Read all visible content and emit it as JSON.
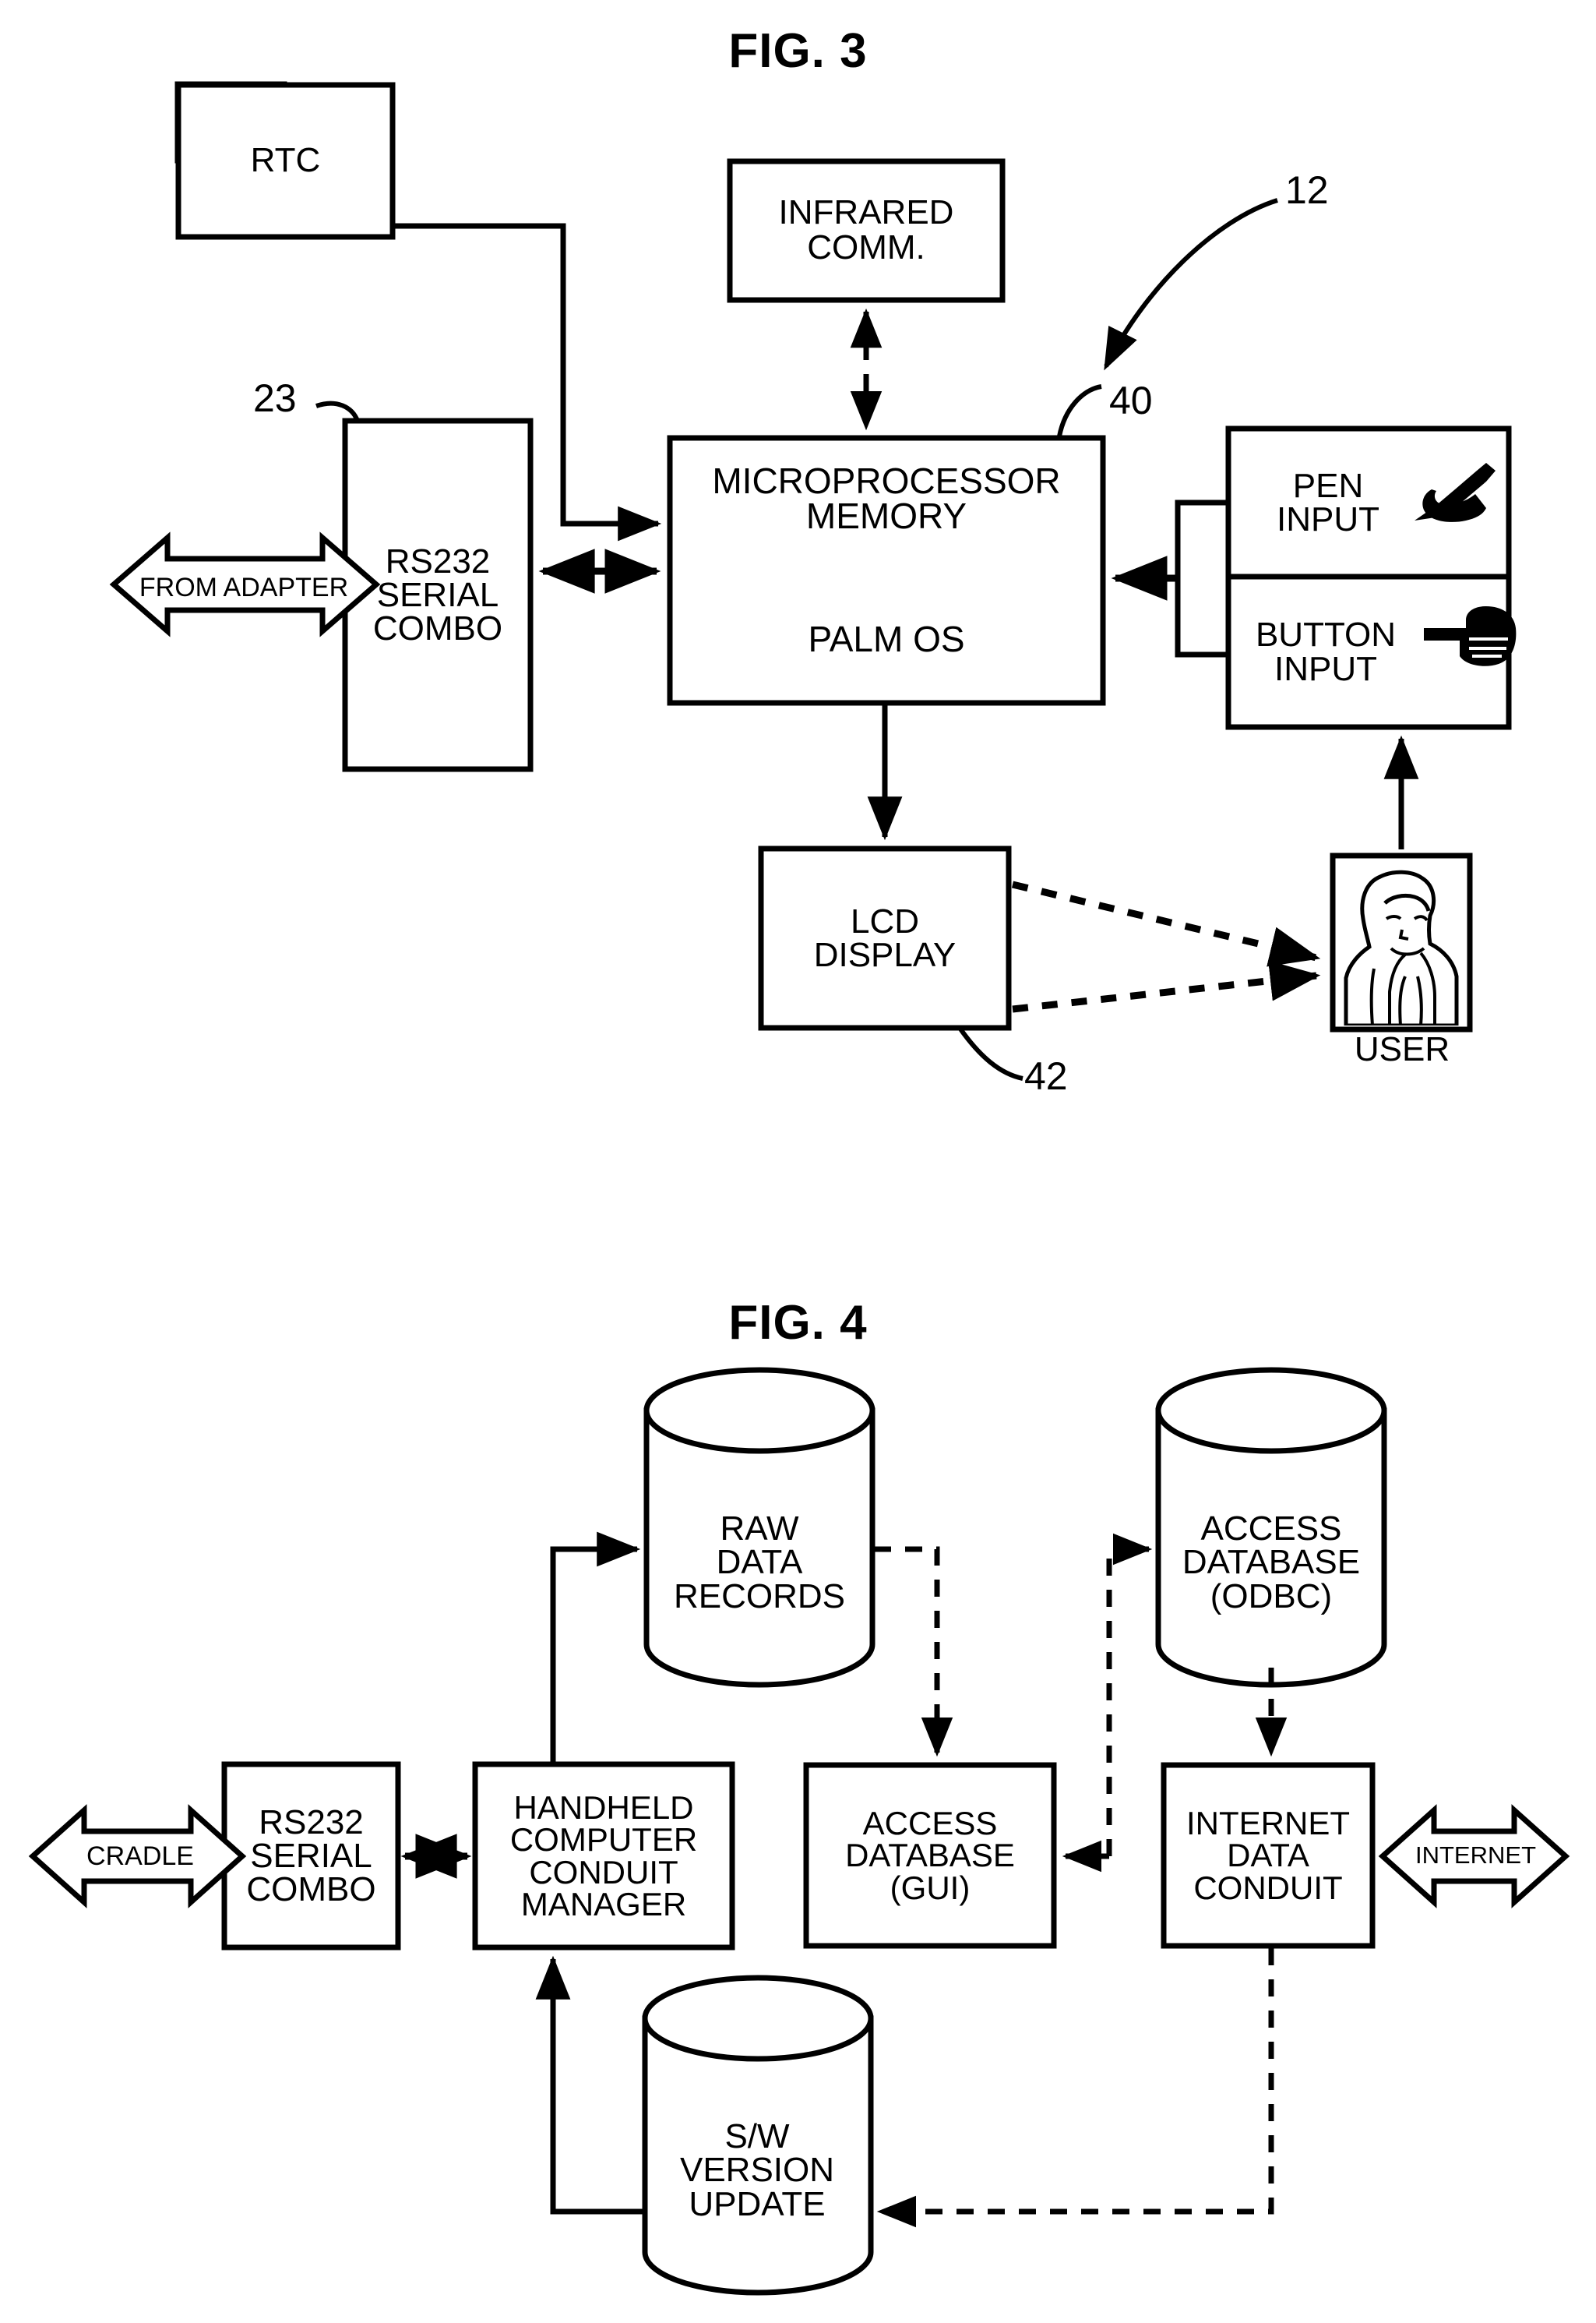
{
  "figures": [
    {
      "id": "fig3",
      "title": "FIG. 3",
      "reference_numbers": [
        "12",
        "23",
        "40",
        "42"
      ],
      "nodes": [
        {
          "id": "rtc",
          "label": "RTC",
          "shape": "rect"
        },
        {
          "id": "infrared",
          "label": "INFRARED\nCOMM.",
          "shape": "rect"
        },
        {
          "id": "rs232",
          "label": "RS232\nSERIAL\nCOMBO",
          "shape": "rect"
        },
        {
          "id": "micro",
          "label": "MICROPROCESSOR\nMEMORY",
          "label2": "PALM OS",
          "shape": "rect"
        },
        {
          "id": "pen",
          "label": "PEN\nINPUT",
          "shape": "rect",
          "icon": "hand-writing-pen-icon"
        },
        {
          "id": "button",
          "label": "BUTTON\nINPUT",
          "shape": "rect",
          "icon": "hand-pointing-finger-icon"
        },
        {
          "id": "lcd",
          "label": "LCD\nDISPLAY",
          "shape": "rect"
        },
        {
          "id": "user",
          "label": "USER",
          "shape": "image-box",
          "icon": "user-portrait-icon"
        }
      ],
      "band_arrows": [
        {
          "id": "from-adapter",
          "label": "FROM ADAPTER",
          "direction": "bidirectional"
        }
      ]
    },
    {
      "id": "fig4",
      "title": "FIG. 4",
      "reference_numbers": [],
      "nodes": [
        {
          "id": "raw-data",
          "label": "RAW\nDATA\nRECORDS",
          "shape": "cylinder"
        },
        {
          "id": "access-odbc",
          "label": "ACCESS\nDATABASE\n(ODBC)",
          "shape": "cylinder"
        },
        {
          "id": "rs232-4",
          "label": "RS232\nSERIAL\nCOMBO",
          "shape": "rect"
        },
        {
          "id": "conduit-mgr",
          "label": "HANDHELD\nCOMPUTER\nCONDUIT\nMANAGER",
          "shape": "rect"
        },
        {
          "id": "access-gui",
          "label": "ACCESS\nDATABASE\n(GUI)",
          "shape": "rect"
        },
        {
          "id": "internet-conduit",
          "label": "INTERNET\nDATA\nCONDUIT",
          "shape": "rect"
        },
        {
          "id": "sw-version",
          "label": "S/W\nVERSION\nUPDATE",
          "shape": "cylinder"
        }
      ],
      "band_arrows": [
        {
          "id": "cradle",
          "label": "CRADLE",
          "direction": "bidirectional"
        },
        {
          "id": "internet",
          "label": "INTERNET",
          "direction": "bidirectional"
        }
      ]
    }
  ],
  "labels": {
    "fig3_title": "FIG. 3",
    "fig4_title": "FIG. 4",
    "rtc": "RTC",
    "infrared_l1": "INFRARED",
    "infrared_l2": "COMM.",
    "rs232_l1": "RS232",
    "rs232_l2": "SERIAL",
    "rs232_l3": "COMBO",
    "micro_l1": "MICROPROCESSOR",
    "micro_l2": "MEMORY",
    "micro_l3": "PALM OS",
    "pen_l1": "PEN",
    "pen_l2": "INPUT",
    "button_l1": "BUTTON",
    "button_l2": "INPUT",
    "lcd_l1": "LCD",
    "lcd_l2": "DISPLAY",
    "user_caption": "USER",
    "from_adapter": "FROM ADAPTER",
    "ref_12": "12",
    "ref_23": "23",
    "ref_40": "40",
    "ref_42": "42",
    "raw_l1": "RAW",
    "raw_l2": "DATA",
    "raw_l3": "RECORDS",
    "odbc_l1": "ACCESS",
    "odbc_l2": "DATABASE",
    "odbc_l3": "(ODBC)",
    "rs232b_l1": "RS232",
    "rs232b_l2": "SERIAL",
    "rs232b_l3": "COMBO",
    "mgr_l1": "HANDHELD",
    "mgr_l2": "COMPUTER",
    "mgr_l3": "CONDUIT",
    "mgr_l4": "MANAGER",
    "gui_l1": "ACCESS",
    "gui_l2": "DATABASE",
    "gui_l3": "(GUI)",
    "idc_l1": "INTERNET",
    "idc_l2": "DATA",
    "idc_l3": "CONDUIT",
    "sw_l1": "S/W",
    "sw_l2": "VERSION",
    "sw_l3": "UPDATE",
    "cradle": "CRADLE",
    "internet": "INTERNET"
  },
  "colors": {
    "ink": "#000000",
    "paper": "#ffffff"
  }
}
